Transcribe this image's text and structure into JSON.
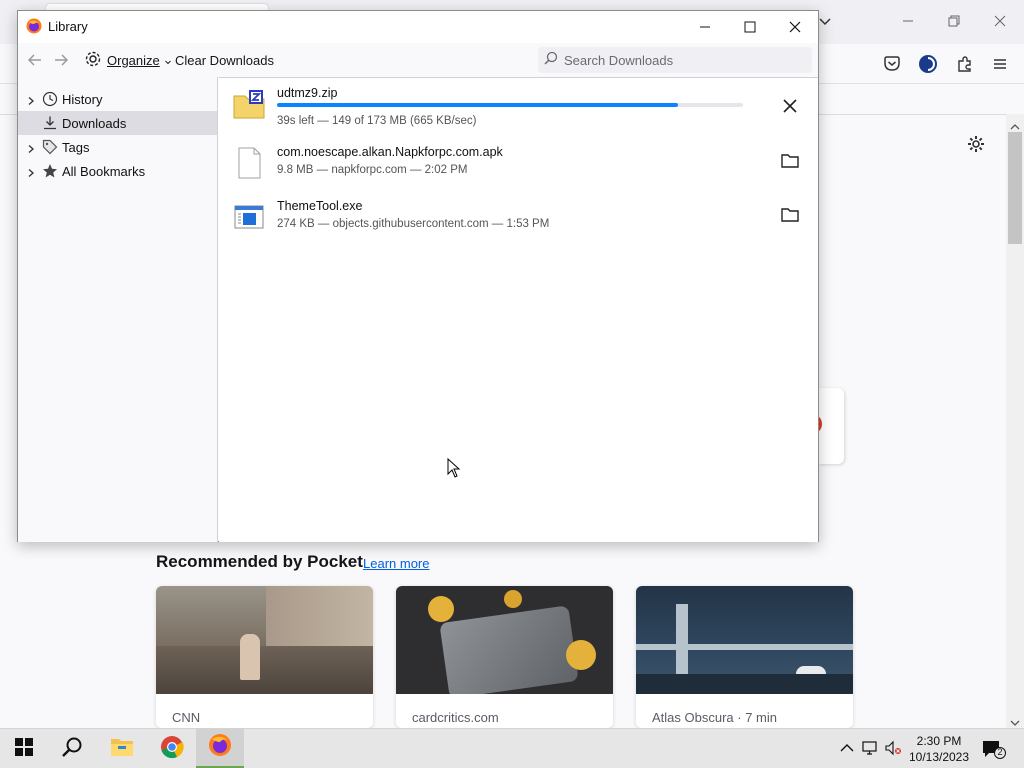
{
  "library": {
    "title": "Library",
    "toolbar": {
      "organize_label": "Organize",
      "clear_label": "Clear Downloads",
      "search_placeholder": "Search Downloads"
    },
    "sidebar": {
      "items": [
        {
          "label": "History",
          "icon": "clock-icon",
          "selected": false
        },
        {
          "label": "Downloads",
          "icon": "download-icon",
          "selected": true
        },
        {
          "label": "Tags",
          "icon": "tag-icon",
          "selected": false
        },
        {
          "label": "All Bookmarks",
          "icon": "star-icon",
          "selected": false
        }
      ]
    },
    "downloads": [
      {
        "name": "udtmz9.zip",
        "status": "39s left — 149 of 173 MB (665 KB/sec)",
        "progress": 0.86,
        "action": "cancel-icon",
        "file_icon": "zip-file-icon"
      },
      {
        "name": "com.noescape.alkan.Napkforpc.com.apk",
        "status": "9.8 MB — napkforpc.com — 2:02 PM",
        "action": "folder-icon",
        "file_icon": "generic-file-icon"
      },
      {
        "name": "ThemeTool.exe",
        "status": "274 KB — objects.githubusercontent.com — 1:53 PM",
        "action": "folder-icon",
        "file_icon": "exe-file-icon"
      }
    ]
  },
  "pocket": {
    "title": "Recommended by Pocket",
    "learn_more": "Learn more",
    "cards": [
      {
        "source": "CNN"
      },
      {
        "source": "cardcritics.com"
      },
      {
        "source": "Atlas Obscura · 7 min"
      }
    ]
  },
  "taskbar": {
    "time": "2:30 PM",
    "date": "10/13/2023",
    "notification_count": "2"
  },
  "colors": {
    "accent": "#0a84ff",
    "link": "#0061e0",
    "selected_bg": "#dcdce2"
  }
}
